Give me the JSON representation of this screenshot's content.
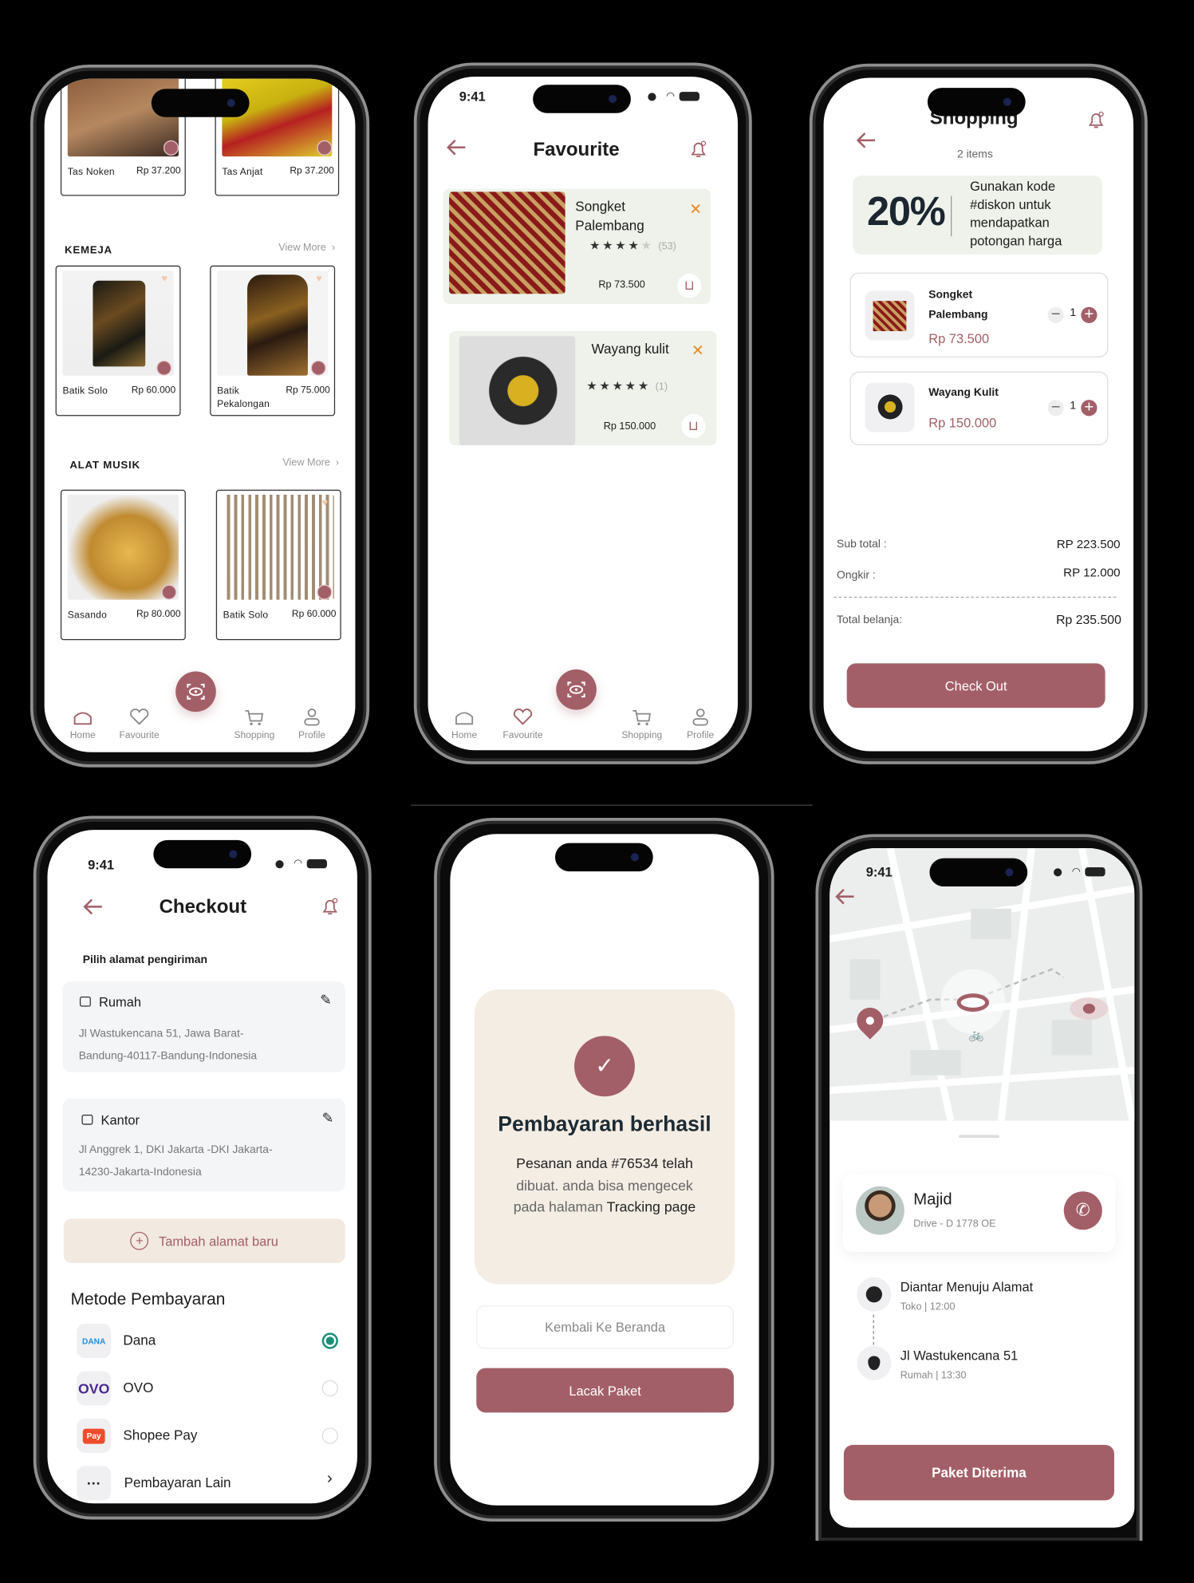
{
  "colors": {
    "accent": "#a35f68",
    "promo_bg": "#eef2ea",
    "beige": "#f4ede4",
    "selected": "#1a8f78"
  },
  "home": {
    "top_products": [
      {
        "name": "Tas Noken",
        "price": "Rp 37.200"
      },
      {
        "name": "Tas Anjat",
        "price": "Rp 37.200"
      }
    ],
    "sections": [
      {
        "title": "KEMEJA",
        "view_more": "View More",
        "products": [
          {
            "name": "Batik Solo",
            "price": "Rp 60.000"
          },
          {
            "name": "Batik Pekalongan",
            "price": "Rp 75.000"
          }
        ]
      },
      {
        "title": "ALAT MUSIK",
        "view_more": "View More",
        "products": [
          {
            "name": "Sasando",
            "price": "Rp 80.000"
          },
          {
            "name": "Batik Solo",
            "price": "Rp 60.000"
          }
        ]
      }
    ]
  },
  "nav": {
    "home": "Home",
    "favourite": "Favourite",
    "shopping": "Shopping",
    "profile": "Profile"
  },
  "favourite": {
    "time": "9:41",
    "title": "Favourite",
    "items": [
      {
        "name": "Songket Palembang",
        "rating": 4,
        "reviews": "(53)",
        "price": "Rp 73.500"
      },
      {
        "name": "Wayang kulit",
        "rating": 5,
        "reviews": "(1)",
        "price": "Rp 150.000"
      }
    ]
  },
  "shopping": {
    "title": "Shopping",
    "count": "2 items",
    "promo": {
      "percent": "20%",
      "text": "Gunakan kode #diskon untuk mendapatkan potongan harga"
    },
    "items": [
      {
        "name": "Songket Palembang",
        "price": "Rp 73.500",
        "qty": "1"
      },
      {
        "name": "Wayang Kulit",
        "price": "Rp 150.000",
        "qty": "1"
      }
    ],
    "subtotal_label": "Sub total :",
    "subtotal": "RP 223.500",
    "ongkir_label": "Ongkir :",
    "ongkir": "RP 12.000",
    "total_label": "Total  belanja:",
    "total": "Rp 235.500",
    "checkout": "Check Out"
  },
  "checkout": {
    "time": "9:41",
    "title": "Checkout",
    "address_heading": "Pilih alamat pengiriman",
    "addresses": [
      {
        "label": "Rumah",
        "line1": "Jl Wastukencana 51, Jawa Barat-",
        "line2": "Bandung-40117-Bandung-Indonesia"
      },
      {
        "label": "Kantor",
        "line1": "Jl Anggrek 1, DKI Jakarta -DKI  Jakarta-",
        "line2": "14230-Jakarta-Indonesia"
      }
    ],
    "add_address": "Tambah alamat baru",
    "payment_heading": "Metode Pembayaran",
    "payments": [
      {
        "label": "Dana",
        "logo": "DANA",
        "selected": true
      },
      {
        "label": "OVO",
        "logo": "OVO",
        "selected": false
      },
      {
        "label": "Shopee Pay",
        "logo": "Pay",
        "selected": false
      },
      {
        "label": "Pembayaran Lain",
        "logo": "···",
        "selected": false
      }
    ]
  },
  "success": {
    "title": "Pembayaran berhasil",
    "msg1": "Pesanan anda #76534 telah",
    "msg2": "dibuat. anda bisa mengecek",
    "msg3": "pada halaman ",
    "msg3b": "Tracking page",
    "back": "Kembali Ke Beranda",
    "track": "Lacak Paket"
  },
  "tracking": {
    "time": "9:41",
    "driver": {
      "name": "Majid",
      "sub": "Drive - D 1778 OE"
    },
    "steps": [
      {
        "title": "Diantar Menuju Alamat",
        "sub": "Toko  |  12:00"
      },
      {
        "title": "Jl Wastukencana 51",
        "sub": "Rumah  |  13:30"
      }
    ],
    "button": "Paket Diterima"
  }
}
